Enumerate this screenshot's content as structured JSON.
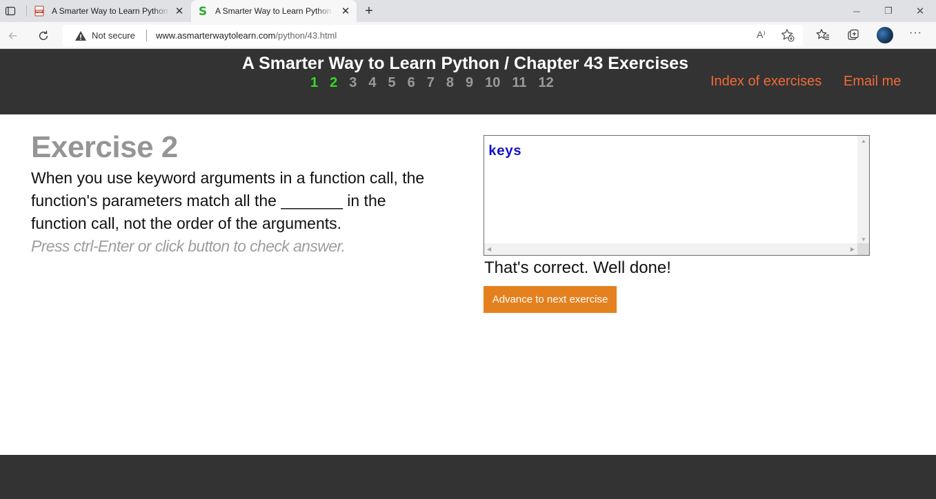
{
  "browser": {
    "tabs": [
      {
        "title": "A Smarter Way to Learn Python - ",
        "favicon": "pdf-icon",
        "active": false
      },
      {
        "title": "A Smarter Way to Learn Python - ",
        "favicon": "s-logo-icon",
        "active": true
      }
    ],
    "new_tab_label": "+",
    "window_controls": {
      "minimize": "─",
      "restore": "❐",
      "close": "✕"
    },
    "security_label": "Not secure",
    "url_host": "www.asmarterwaytolearn.com",
    "url_path": "/python/43.html",
    "read_aloud_glyph": "A⁾"
  },
  "header": {
    "title": "A Smarter Way to Learn Python / Chapter 43 Exercises",
    "exercise_numbers": [
      {
        "label": "1",
        "done": true
      },
      {
        "label": "2",
        "done": true
      },
      {
        "label": "3",
        "done": false
      },
      {
        "label": "4",
        "done": false
      },
      {
        "label": "5",
        "done": false
      },
      {
        "label": "6",
        "done": false
      },
      {
        "label": "7",
        "done": false
      },
      {
        "label": "8",
        "done": false
      },
      {
        "label": "9",
        "done": false
      },
      {
        "label": "10",
        "done": false
      },
      {
        "label": "11",
        "done": false
      },
      {
        "label": "12",
        "done": false
      }
    ],
    "index_link": "Index of exercises",
    "email_link": "Email me"
  },
  "exercise": {
    "title": "Exercise 2",
    "question_line1": "When you use keyword arguments in a function call, the",
    "question_line2": "function's parameters match all the _______ in the",
    "question_line3": "function call, not the order of the arguments.",
    "hint": "Press ctrl-Enter or click button to check answer."
  },
  "answer": {
    "value": "keys",
    "feedback": "That's correct. Well done!",
    "next_button": "Advance to next exercise"
  },
  "colors": {
    "header_bg": "#333333",
    "done_number": "#33dd22",
    "pending_number": "#9a9a9a",
    "link": "#f06a3a",
    "button": "#e5801f",
    "answer_text": "#1010cc"
  }
}
